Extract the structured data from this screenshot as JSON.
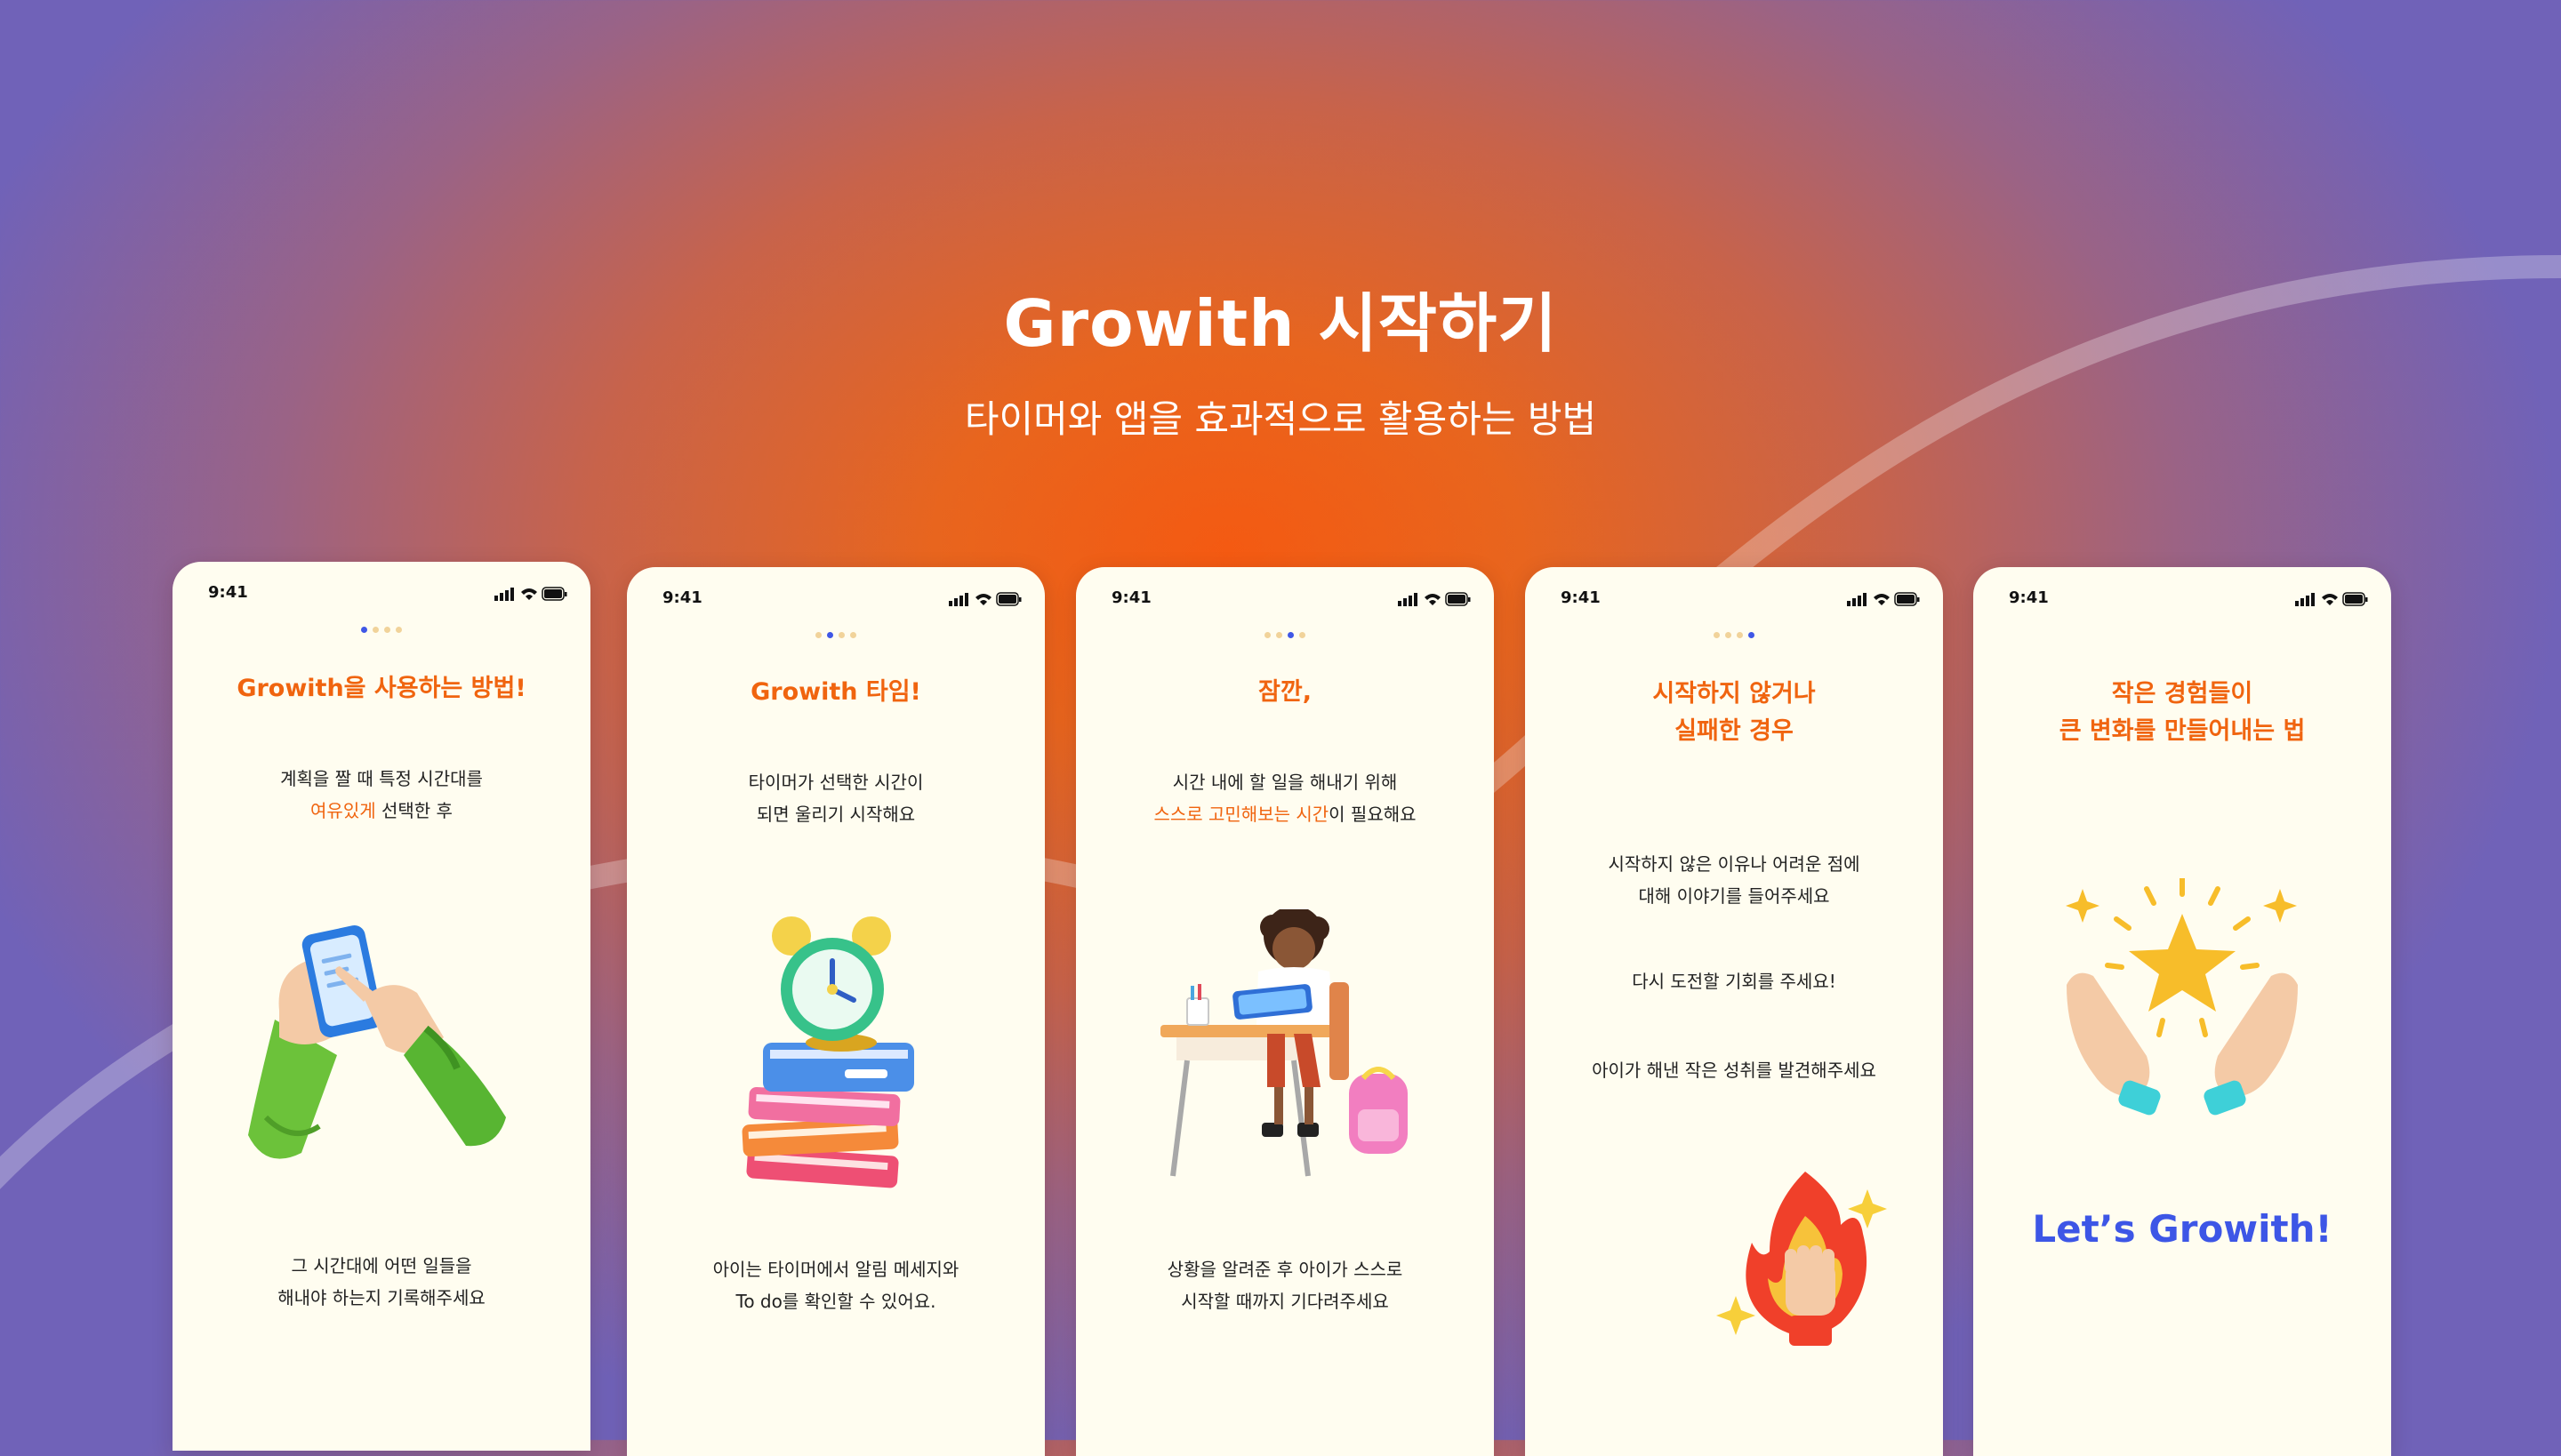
{
  "hero": {
    "title": "Growith 시작하기",
    "subtitle": "타이머와 앱을 효과적으로 활용하는 방법"
  },
  "status_time": "9:41",
  "colors": {
    "accent_orange": "#f0640f",
    "accent_blue": "#3d56e6",
    "card_bg": "#fffdf0",
    "dot_inactive": "#f1d39a"
  },
  "screens": [
    {
      "title": "Growith을 사용하는 방법!",
      "text1_line1": "계획을 짤 때 특정 시간대를",
      "text1_hl": "여유있게",
      "text1_rest": " 선택한 후",
      "text2_line1": "그 시간대에 어떤 일들을",
      "text2_line2": "해내야 하는지 기록해주세요",
      "active_dot": 1,
      "illustration": "phone-hands-icon"
    },
    {
      "title": "Growith 타임!",
      "text1_line1": "타이머가 선택한 시간이",
      "text1_line2": "되면 울리기 시작해요",
      "text2_line1": "아이는 타이머에서 알림 메세지와",
      "text2_line2": "To do를 확인할 수 있어요.",
      "active_dot": 2,
      "illustration": "alarm-clock-books-icon"
    },
    {
      "title": "잠깐,",
      "text1_line1": "시간 내에 할 일을 해내기 위해",
      "text1_hl": "스스로 고민해보는 시간",
      "text1_rest": "이 필요해요",
      "text2_line1": "상황을 알려준 후 아이가 스스로",
      "text2_line2": "시작할 때까지 기다려주세요",
      "active_dot": 3,
      "illustration": "child-at-desk-icon"
    },
    {
      "title_line1": "시작하지 않거나",
      "title_line2": "실패한 경우",
      "text1_line1": "시작하지 않은 이유나 어려운 점에",
      "text1_line2": "대해 이야기를 들어주세요",
      "text2": "다시 도전할 기회를 주세요!",
      "text3": "아이가 해낸 작은 성취를 발견해주세요",
      "active_dot": 4,
      "illustration": "flaming-fist-icon"
    },
    {
      "title_line1": "작은 경험들이",
      "title_line2": "큰 변화를 만들어내는 법",
      "cta": "Let’s Growith!",
      "illustration": "hands-star-icon"
    }
  ]
}
